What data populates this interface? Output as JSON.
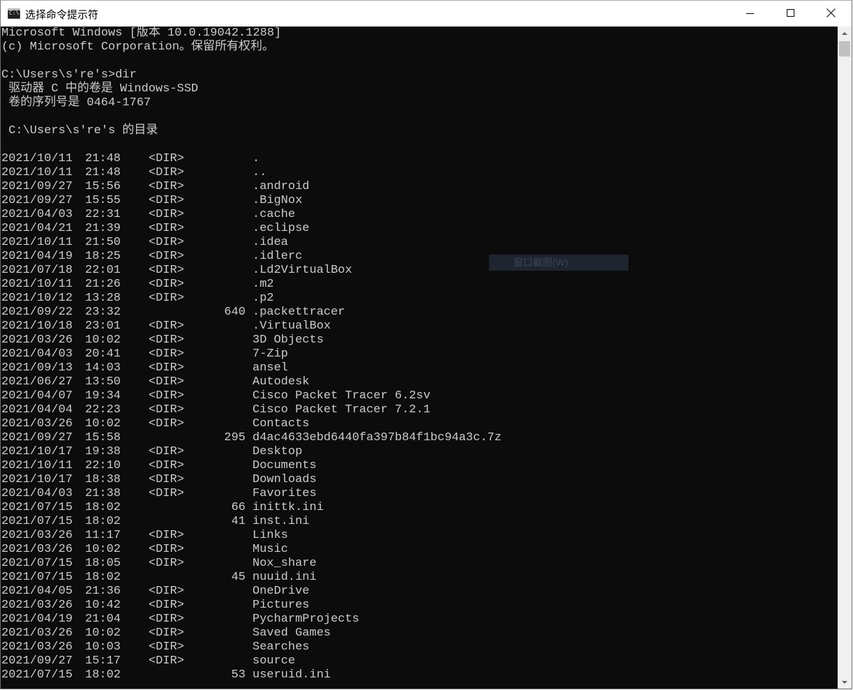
{
  "window": {
    "title": "选择命令提示符",
    "icon": "cmd-icon",
    "controls": [
      "minimize-icon",
      "maximize-icon",
      "close-icon"
    ]
  },
  "console": {
    "header": [
      "Microsoft Windows [版本 10.0.19042.1288]",
      "(c) Microsoft Corporation。保留所有权利。",
      "",
      "C:\\Users\\s're's>dir",
      " 驱动器 C 中的卷是 Windows-SSD",
      " 卷的序列号是 0464-1767",
      "",
      " C:\\Users\\s're's 的目录",
      ""
    ],
    "entries": [
      {
        "date": "2021/10/11",
        "time": "21:48",
        "type": "<DIR>",
        "size": "",
        "name": "."
      },
      {
        "date": "2021/10/11",
        "time": "21:48",
        "type": "<DIR>",
        "size": "",
        "name": ".."
      },
      {
        "date": "2021/09/27",
        "time": "15:56",
        "type": "<DIR>",
        "size": "",
        "name": ".android"
      },
      {
        "date": "2021/09/27",
        "time": "15:55",
        "type": "<DIR>",
        "size": "",
        "name": ".BigNox"
      },
      {
        "date": "2021/04/03",
        "time": "22:31",
        "type": "<DIR>",
        "size": "",
        "name": ".cache"
      },
      {
        "date": "2021/04/21",
        "time": "21:39",
        "type": "<DIR>",
        "size": "",
        "name": ".eclipse"
      },
      {
        "date": "2021/10/11",
        "time": "21:50",
        "type": "<DIR>",
        "size": "",
        "name": ".idea"
      },
      {
        "date": "2021/04/19",
        "time": "18:25",
        "type": "<DIR>",
        "size": "",
        "name": ".idlerc"
      },
      {
        "date": "2021/07/18",
        "time": "22:01",
        "type": "<DIR>",
        "size": "",
        "name": ".Ld2VirtualBox"
      },
      {
        "date": "2021/10/11",
        "time": "21:26",
        "type": "<DIR>",
        "size": "",
        "name": ".m2"
      },
      {
        "date": "2021/10/12",
        "time": "13:28",
        "type": "<DIR>",
        "size": "",
        "name": ".p2"
      },
      {
        "date": "2021/09/22",
        "time": "23:32",
        "type": "",
        "size": "640",
        "name": ".packettracer"
      },
      {
        "date": "2021/10/18",
        "time": "23:01",
        "type": "<DIR>",
        "size": "",
        "name": ".VirtualBox"
      },
      {
        "date": "2021/03/26",
        "time": "10:02",
        "type": "<DIR>",
        "size": "",
        "name": "3D Objects"
      },
      {
        "date": "2021/04/03",
        "time": "20:41",
        "type": "<DIR>",
        "size": "",
        "name": "7-Zip"
      },
      {
        "date": "2021/09/13",
        "time": "14:03",
        "type": "<DIR>",
        "size": "",
        "name": "ansel"
      },
      {
        "date": "2021/06/27",
        "time": "13:50",
        "type": "<DIR>",
        "size": "",
        "name": "Autodesk"
      },
      {
        "date": "2021/04/07",
        "time": "19:34",
        "type": "<DIR>",
        "size": "",
        "name": "Cisco Packet Tracer 6.2sv"
      },
      {
        "date": "2021/04/04",
        "time": "22:23",
        "type": "<DIR>",
        "size": "",
        "name": "Cisco Packet Tracer 7.2.1"
      },
      {
        "date": "2021/03/26",
        "time": "10:02",
        "type": "<DIR>",
        "size": "",
        "name": "Contacts"
      },
      {
        "date": "2021/09/27",
        "time": "15:58",
        "type": "",
        "size": "295",
        "name": "d4ac4633ebd6440fa397b84f1bc94a3c.7z"
      },
      {
        "date": "2021/10/17",
        "time": "19:38",
        "type": "<DIR>",
        "size": "",
        "name": "Desktop"
      },
      {
        "date": "2021/10/11",
        "time": "22:10",
        "type": "<DIR>",
        "size": "",
        "name": "Documents"
      },
      {
        "date": "2021/10/17",
        "time": "18:38",
        "type": "<DIR>",
        "size": "",
        "name": "Downloads"
      },
      {
        "date": "2021/04/03",
        "time": "21:38",
        "type": "<DIR>",
        "size": "",
        "name": "Favorites"
      },
      {
        "date": "2021/07/15",
        "time": "18:02",
        "type": "",
        "size": "66",
        "name": "inittk.ini"
      },
      {
        "date": "2021/07/15",
        "time": "18:02",
        "type": "",
        "size": "41",
        "name": "inst.ini"
      },
      {
        "date": "2021/03/26",
        "time": "11:17",
        "type": "<DIR>",
        "size": "",
        "name": "Links"
      },
      {
        "date": "2021/03/26",
        "time": "10:02",
        "type": "<DIR>",
        "size": "",
        "name": "Music"
      },
      {
        "date": "2021/07/15",
        "time": "18:05",
        "type": "<DIR>",
        "size": "",
        "name": "Nox_share"
      },
      {
        "date": "2021/07/15",
        "time": "18:02",
        "type": "",
        "size": "45",
        "name": "nuuid.ini"
      },
      {
        "date": "2021/04/05",
        "time": "21:36",
        "type": "<DIR>",
        "size": "",
        "name": "OneDrive"
      },
      {
        "date": "2021/03/26",
        "time": "10:42",
        "type": "<DIR>",
        "size": "",
        "name": "Pictures"
      },
      {
        "date": "2021/04/19",
        "time": "21:04",
        "type": "<DIR>",
        "size": "",
        "name": "PycharmProjects"
      },
      {
        "date": "2021/03/26",
        "time": "10:02",
        "type": "<DIR>",
        "size": "",
        "name": "Saved Games"
      },
      {
        "date": "2021/03/26",
        "time": "10:03",
        "type": "<DIR>",
        "size": "",
        "name": "Searches"
      },
      {
        "date": "2021/09/27",
        "time": "15:17",
        "type": "<DIR>",
        "size": "",
        "name": "source"
      },
      {
        "date": "2021/07/15",
        "time": "18:02",
        "type": "",
        "size": "53",
        "name": "useruid.ini"
      }
    ]
  },
  "tooltip": {
    "text": "窗口截图(W)"
  },
  "colors": {
    "console_bg": "#0c0c0c",
    "console_fg": "#cccccc",
    "titlebar_bg": "#ffffff"
  }
}
